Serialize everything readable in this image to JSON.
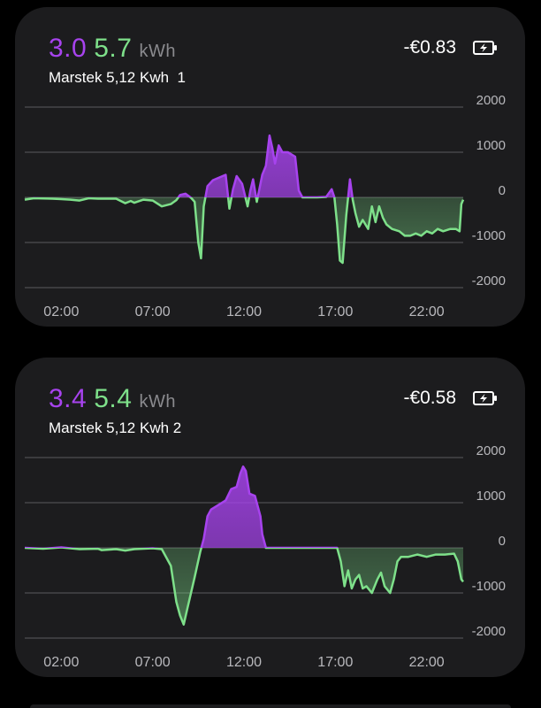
{
  "colors": {
    "charge": "#a743ee",
    "discharge": "#7ee08a",
    "card_bg": "#1c1c1e",
    "grid": "#5a5a5e",
    "text_secondary": "#b8b8bc"
  },
  "cards": [
    {
      "charge_kwh": "3.0",
      "discharge_kwh": "5.7",
      "unit": "kWh",
      "device": "Marstek 5,12 Kwh  1",
      "cost": "-€0.83",
      "battery_icon": "battery-charging-icon"
    },
    {
      "charge_kwh": "3.4",
      "discharge_kwh": "5.4",
      "unit": "kWh",
      "device": "Marstek 5,12 Kwh 2",
      "cost": "-€0.58",
      "battery_icon": "battery-charging-icon"
    }
  ],
  "chart_data": [
    {
      "type": "area",
      "x_ticks": [
        "02:00",
        "07:00",
        "12:00",
        "17:00",
        "22:00"
      ],
      "x_tick_hours": [
        2,
        7,
        12,
        17,
        22
      ],
      "y_ticks": [
        "2000",
        "1000",
        "0",
        "-1000",
        "-2000"
      ],
      "y_tick_values": [
        2000,
        1000,
        0,
        -1000,
        -2000
      ],
      "ylim": [
        -2000,
        2000
      ],
      "xlim": [
        0,
        24
      ],
      "grid": true,
      "points": [
        [
          0,
          -50
        ],
        [
          0.5,
          -20
        ],
        [
          1.5,
          -30
        ],
        [
          2,
          -40
        ],
        [
          2.5,
          -50
        ],
        [
          3,
          -70
        ],
        [
          3.5,
          -20
        ],
        [
          4,
          -30
        ],
        [
          4.5,
          -30
        ],
        [
          5,
          -30
        ],
        [
          5.5,
          -130
        ],
        [
          5.8,
          -80
        ],
        [
          6,
          -120
        ],
        [
          6.5,
          -50
        ],
        [
          7,
          -70
        ],
        [
          7.5,
          -200
        ],
        [
          8,
          -150
        ],
        [
          8.3,
          -60
        ],
        [
          8.5,
          50
        ],
        [
          8.8,
          80
        ],
        [
          9.1,
          -10
        ],
        [
          9.3,
          -100
        ],
        [
          9.5,
          -1000
        ],
        [
          9.65,
          -1350
        ],
        [
          9.8,
          -200
        ],
        [
          10,
          250
        ],
        [
          10.3,
          380
        ],
        [
          10.7,
          450
        ],
        [
          11,
          500
        ],
        [
          11.2,
          -250
        ],
        [
          11.4,
          180
        ],
        [
          11.6,
          470
        ],
        [
          11.9,
          300
        ],
        [
          12.2,
          -200
        ],
        [
          12.35,
          150
        ],
        [
          12.5,
          400
        ],
        [
          12.7,
          -100
        ],
        [
          12.85,
          200
        ],
        [
          13,
          500
        ],
        [
          13.2,
          700
        ],
        [
          13.4,
          1370
        ],
        [
          13.55,
          1100
        ],
        [
          13.7,
          750
        ],
        [
          13.9,
          1150
        ],
        [
          14.1,
          1000
        ],
        [
          14.4,
          1000
        ],
        [
          14.8,
          900
        ],
        [
          15,
          150
        ],
        [
          15.2,
          0
        ],
        [
          15.5,
          0
        ],
        [
          16,
          0
        ],
        [
          16.5,
          10
        ],
        [
          16.8,
          180
        ],
        [
          16.95,
          0
        ],
        [
          17.1,
          -600
        ],
        [
          17.25,
          -1400
        ],
        [
          17.4,
          -1450
        ],
        [
          17.6,
          -400
        ],
        [
          17.8,
          400
        ],
        [
          17.95,
          -50
        ],
        [
          18.1,
          -350
        ],
        [
          18.3,
          -650
        ],
        [
          18.5,
          -500
        ],
        [
          18.8,
          -700
        ],
        [
          19,
          -200
        ],
        [
          19.2,
          -550
        ],
        [
          19.4,
          -200
        ],
        [
          19.6,
          -450
        ],
        [
          19.8,
          -600
        ],
        [
          20.1,
          -700
        ],
        [
          20.5,
          -750
        ],
        [
          20.8,
          -850
        ],
        [
          21.1,
          -850
        ],
        [
          21.4,
          -800
        ],
        [
          21.7,
          -850
        ],
        [
          22,
          -750
        ],
        [
          22.3,
          -800
        ],
        [
          22.6,
          -700
        ],
        [
          22.9,
          -750
        ],
        [
          23.3,
          -700
        ],
        [
          23.6,
          -700
        ],
        [
          23.8,
          -750
        ],
        [
          23.9,
          -150
        ],
        [
          24,
          -50
        ]
      ]
    },
    {
      "type": "area",
      "x_ticks": [
        "02:00",
        "07:00",
        "12:00",
        "17:00",
        "22:00"
      ],
      "x_tick_hours": [
        2,
        7,
        12,
        17,
        22
      ],
      "y_ticks": [
        "2000",
        "1000",
        "0",
        "-1000",
        "-2000"
      ],
      "y_tick_values": [
        2000,
        1000,
        0,
        -1000,
        -2000
      ],
      "ylim": [
        -2000,
        2000
      ],
      "xlim": [
        0,
        24
      ],
      "grid": true,
      "points": [
        [
          0,
          0
        ],
        [
          1,
          -20
        ],
        [
          2,
          10
        ],
        [
          3,
          -30
        ],
        [
          4,
          -20
        ],
        [
          4.2,
          -50
        ],
        [
          5,
          -30
        ],
        [
          5.5,
          -60
        ],
        [
          6,
          -30
        ],
        [
          7,
          -10
        ],
        [
          7.5,
          -30
        ],
        [
          8,
          -400
        ],
        [
          8.3,
          -1200
        ],
        [
          8.5,
          -1500
        ],
        [
          8.7,
          -1700
        ],
        [
          8.9,
          -1350
        ],
        [
          9.3,
          -650
        ],
        [
          9.6,
          -100
        ],
        [
          9.8,
          200
        ],
        [
          10,
          700
        ],
        [
          10.2,
          850
        ],
        [
          10.6,
          950
        ],
        [
          11,
          1050
        ],
        [
          11.3,
          1300
        ],
        [
          11.6,
          1350
        ],
        [
          11.8,
          1650
        ],
        [
          11.95,
          1800
        ],
        [
          12.1,
          1700
        ],
        [
          12.3,
          1200
        ],
        [
          12.6,
          1150
        ],
        [
          12.9,
          700
        ],
        [
          13,
          300
        ],
        [
          13.2,
          0
        ],
        [
          14,
          0
        ],
        [
          16,
          0
        ],
        [
          17,
          0
        ],
        [
          17.1,
          0
        ],
        [
          17.3,
          -300
        ],
        [
          17.5,
          -850
        ],
        [
          17.7,
          -500
        ],
        [
          17.9,
          -900
        ],
        [
          18.1,
          -700
        ],
        [
          18.3,
          -600
        ],
        [
          18.5,
          -900
        ],
        [
          18.7,
          -850
        ],
        [
          19,
          -1000
        ],
        [
          19.3,
          -700
        ],
        [
          19.5,
          -550
        ],
        [
          19.7,
          -850
        ],
        [
          20,
          -1000
        ],
        [
          20.2,
          -700
        ],
        [
          20.4,
          -300
        ],
        [
          20.6,
          -200
        ],
        [
          21,
          -200
        ],
        [
          21.5,
          -150
        ],
        [
          22,
          -200
        ],
        [
          22.5,
          -150
        ],
        [
          23,
          -150
        ],
        [
          23.5,
          -130
        ],
        [
          23.7,
          -300
        ],
        [
          23.9,
          -700
        ],
        [
          24,
          -750
        ]
      ]
    }
  ]
}
